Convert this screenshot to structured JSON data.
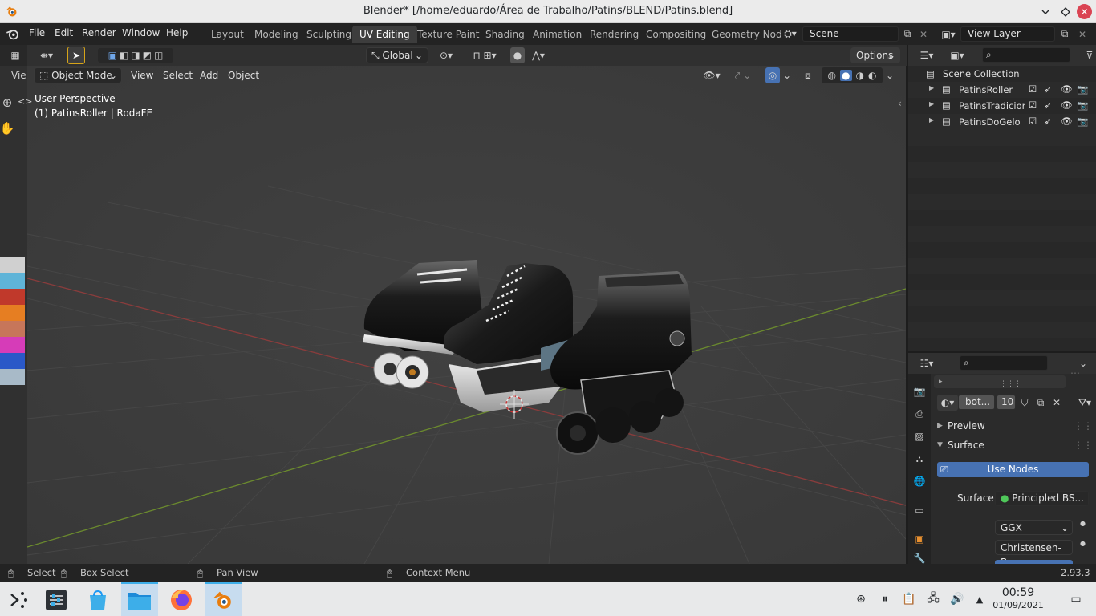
{
  "window": {
    "title": "Blender* [/home/eduardo/Área de Trabalho/Patins/BLEND/Patins.blend]",
    "controls": [
      "chevron-down-icon",
      "diamond-icon",
      "close-icon"
    ]
  },
  "menubar": {
    "items": [
      "File",
      "Edit",
      "Render",
      "Window",
      "Help"
    ]
  },
  "workspaces": {
    "tabs": [
      "Layout",
      "Modeling",
      "Sculpting",
      "UV Editing",
      "Texture Paint",
      "Shading",
      "Animation",
      "Rendering",
      "Compositing",
      "Geometry Nod"
    ],
    "active": "UV Editing"
  },
  "scene": {
    "name": "Scene"
  },
  "view_layer": {
    "name": "View Layer"
  },
  "tool_header": {
    "orientation": "Global",
    "options_label": "Options",
    "left_label": "Vie"
  },
  "viewport_header": {
    "mode": "Object Mode",
    "menus": [
      "View",
      "Select",
      "Add",
      "Object"
    ]
  },
  "viewport": {
    "perspective_label": "User Perspective",
    "active_object_label": "(1) PatinsRoller | RodaFE",
    "grid": true,
    "colors": {
      "background": "#3d3d3d",
      "x_axis": "#8a3c3c",
      "y_axis": "#6b8a2e"
    }
  },
  "outliner": {
    "root": "Scene Collection",
    "collections": [
      {
        "name": "PatinsRoller"
      },
      {
        "name": "PatinsTradiciona"
      },
      {
        "name": "PatinsDoGelo"
      }
    ]
  },
  "properties": {
    "material_name": "bot...",
    "user_count": "10",
    "panels": {
      "preview": "Preview",
      "surface": "Surface"
    },
    "use_nodes_label": "Use Nodes",
    "surface_label": "Surface",
    "surface_shader": "Principled BS...",
    "distribution": "GGX",
    "subsurface_method": "Christensen-B..."
  },
  "statusbar": {
    "items": [
      "Select",
      "Box Select",
      "Pan View",
      "Context Menu"
    ],
    "version": "2.93.3"
  },
  "taskbar": {
    "time": "00:59",
    "date": "01/09/2021",
    "apps": [
      "application-launcher-icon",
      "system-settings-icon",
      "discover-store-icon",
      "file-manager-icon",
      "firefox-icon",
      "blender-icon"
    ]
  },
  "palette": [
    "#d0d0d0",
    "#5fb4d8",
    "#c0392b",
    "#e67e22",
    "#c7765a",
    "#d63cb8",
    "#2a58c8",
    "#a8bac8"
  ]
}
